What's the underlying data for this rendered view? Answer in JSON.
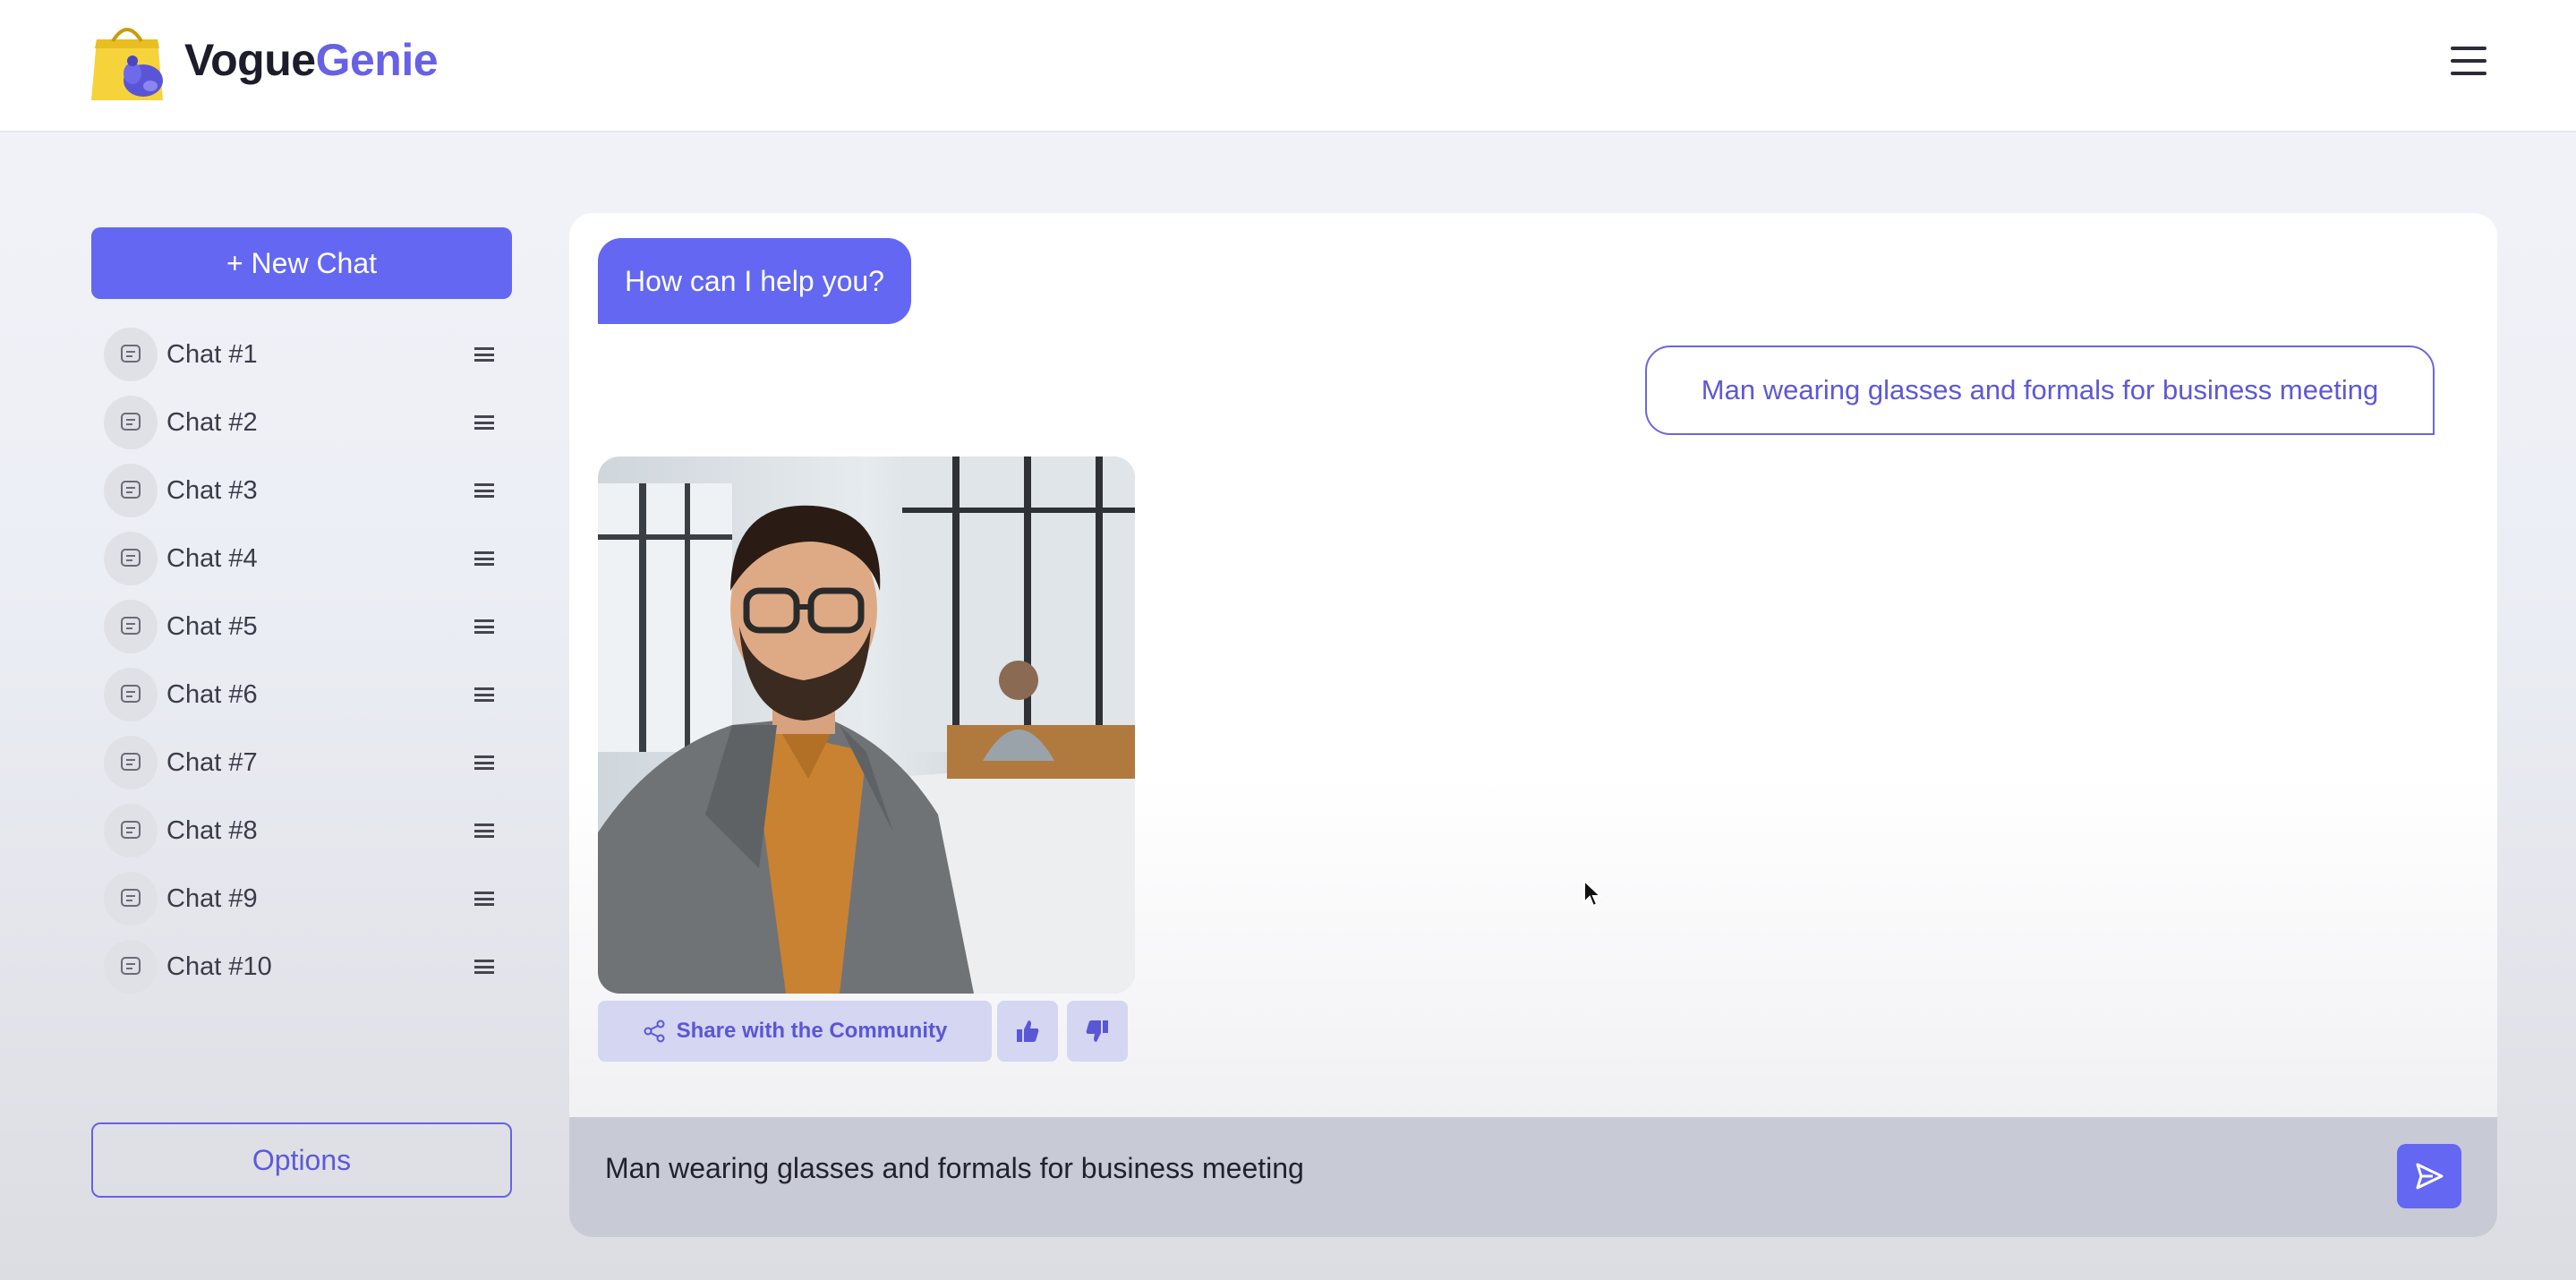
{
  "brand": {
    "name_part1": "Vogue",
    "name_part2": "Genie",
    "logo_icon": "shopping-bag-genie-icon",
    "colors": {
      "dark": "#1c1c2a",
      "accent": "#6761e6"
    }
  },
  "header": {
    "menu_icon": "hamburger-menu-icon"
  },
  "sidebar": {
    "new_chat_label": "+ New Chat",
    "chats": [
      {
        "label": "Chat #1"
      },
      {
        "label": "Chat #2"
      },
      {
        "label": "Chat #3"
      },
      {
        "label": "Chat #4"
      },
      {
        "label": "Chat #5"
      },
      {
        "label": "Chat #6"
      },
      {
        "label": "Chat #7"
      },
      {
        "label": "Chat #8"
      },
      {
        "label": "Chat #9"
      },
      {
        "label": "Chat #10"
      }
    ],
    "options_label": "Options"
  },
  "conversation": {
    "bot_greeting": "How can I help you?",
    "user_message": "Man wearing glasses and formals for business meeting",
    "generated_image": "generated-fashion-image-man-glasses-blazer",
    "share_label": "Share with the Community",
    "like_icon": "thumbs-up-icon",
    "dislike_icon": "thumbs-down-icon"
  },
  "composer": {
    "value": "Man wearing glasses and formals for business meeting",
    "send_icon": "send-icon",
    "accent": "#6367f2"
  }
}
